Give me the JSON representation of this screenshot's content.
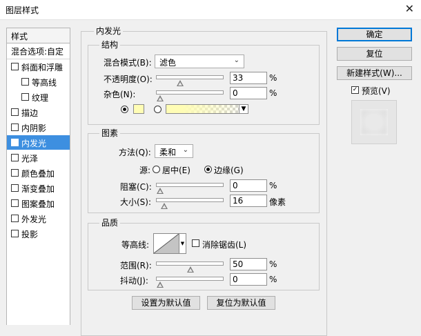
{
  "window": {
    "title": "图层样式",
    "close_glyph": "✕"
  },
  "sidebar": {
    "header": "样式",
    "blending": "混合选项:自定",
    "items": [
      {
        "label": "斜面和浮雕",
        "checked": false,
        "indent": false
      },
      {
        "label": "等高线",
        "checked": false,
        "indent": true
      },
      {
        "label": "纹理",
        "checked": false,
        "indent": true
      },
      {
        "label": "描边",
        "checked": false,
        "indent": false
      },
      {
        "label": "内阴影",
        "checked": false,
        "indent": false
      },
      {
        "label": "内发光",
        "checked": true,
        "indent": false,
        "selected": true
      },
      {
        "label": "光泽",
        "checked": false,
        "indent": false
      },
      {
        "label": "颜色叠加",
        "checked": false,
        "indent": false
      },
      {
        "label": "渐变叠加",
        "checked": false,
        "indent": false
      },
      {
        "label": "图案叠加",
        "checked": false,
        "indent": false
      },
      {
        "label": "外发光",
        "checked": false,
        "indent": false
      },
      {
        "label": "投影",
        "checked": false,
        "indent": false
      }
    ],
    "check_glyph": "✓"
  },
  "panel": {
    "title": "内发光",
    "structure": {
      "title": "结构",
      "blend_mode_label": "混合模式(B):",
      "blend_mode_value": "滤色",
      "opacity_label": "不透明度(O):",
      "opacity_value": "33",
      "opacity_unit": "%",
      "opacity_level": 0.33,
      "noise_label": "杂色(N):",
      "noise_value": "0",
      "noise_unit": "%",
      "noise_level": 0,
      "swatch_color": "#fffdb5",
      "color_mode": "solid"
    },
    "elements": {
      "title": "图素",
      "method_label": "方法(Q):",
      "method_value": "柔和",
      "source_label": "源:",
      "source_center": "居中(E)",
      "source_edge": "边缘(G)",
      "source_selected": "edge",
      "choke_label": "阻塞(C):",
      "choke_value": "0",
      "choke_unit": "%",
      "choke_level": 0,
      "size_label": "大小(S):",
      "size_value": "16",
      "size_unit": "像素",
      "size_level": 0.064
    },
    "quality": {
      "title": "品质",
      "contour_label": "等高线:",
      "antialias_label": "消除锯齿(L)",
      "antialias_checked": false,
      "range_label": "范围(R):",
      "range_value": "50",
      "range_unit": "%",
      "range_level": 0.5,
      "jitter_label": "抖动(J):",
      "jitter_value": "0",
      "jitter_unit": "%",
      "jitter_level": 0
    },
    "make_default": "设置为默认值",
    "reset_default": "复位为默认值"
  },
  "buttons": {
    "ok": "确定",
    "reset": "复位",
    "new_style": "新建样式(W)...",
    "preview_label": "预览(V)",
    "preview_checked": true
  },
  "colors": {
    "selection": "#3d8fe0",
    "glow": "#fffdb5",
    "default_button_border": "#0078d7"
  }
}
